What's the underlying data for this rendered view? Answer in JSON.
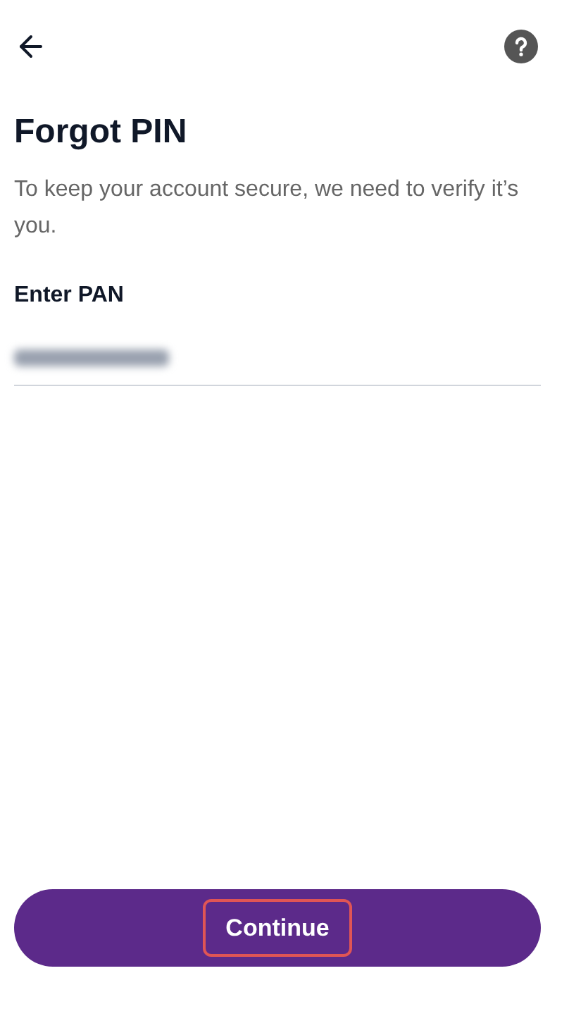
{
  "title": "Forgot PIN",
  "subtitle": "To keep your account secure, we need to verify it’s you.",
  "field": {
    "label": "Enter PAN",
    "value_blurred": true
  },
  "button": {
    "label": "Continue",
    "highlighted": true
  }
}
